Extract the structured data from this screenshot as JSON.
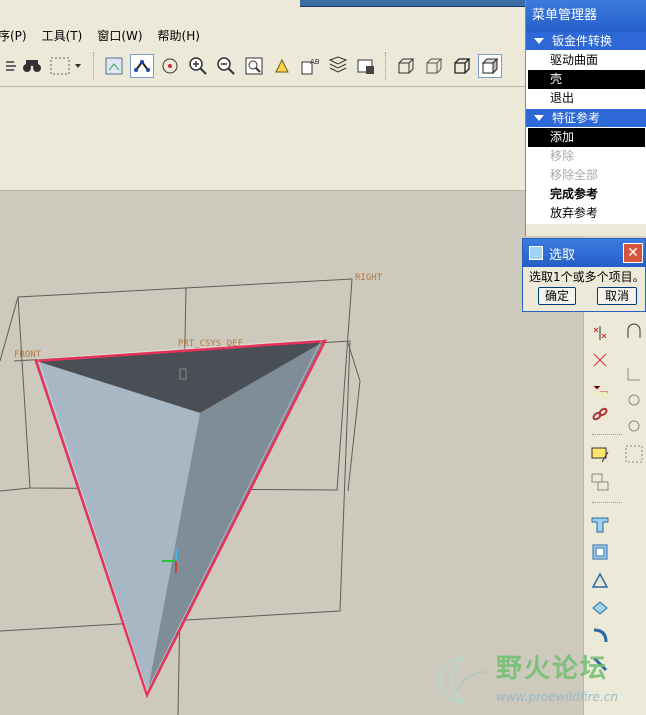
{
  "menubar": {
    "items": [
      "序(P)",
      "工具(T)",
      "窗口(W)",
      "帮助(H)"
    ]
  },
  "menu_manager": {
    "title": "菜单管理器",
    "section1": {
      "label": "钣金件转换",
      "items": [
        {
          "label": "驱动曲面",
          "state": "normal"
        },
        {
          "label": "壳",
          "state": "selected"
        },
        {
          "label": "退出",
          "state": "normal"
        }
      ]
    },
    "section2": {
      "label": "特征参考",
      "items": [
        {
          "label": "添加",
          "state": "selected"
        },
        {
          "label": "移除",
          "state": "disabled"
        },
        {
          "label": "移除全部",
          "state": "disabled"
        },
        {
          "label": "完成参考",
          "state": "bold"
        },
        {
          "label": "放弃参考",
          "state": "normal"
        }
      ]
    }
  },
  "select_dialog": {
    "title": "选取",
    "message": "选取1个或多个项目。",
    "ok_label": "确定",
    "cancel_label": "取消",
    "close_glyph": "✕"
  },
  "viewport": {
    "datum_labels": {
      "right": "RIGHT",
      "front": "FRONT",
      "csys": "PRT_CSYS_DEF"
    }
  },
  "watermark": {
    "title": "野火论坛",
    "url": "www.proewildfire.cn"
  },
  "colors": {
    "menu_title": "#2f6bd2",
    "selected_item": "#000000",
    "model_face_light": "#a7b7c4",
    "model_face_dark": "#4a4e55",
    "highlight_edge": "#e8315a",
    "datum_label": "#b07a40"
  }
}
